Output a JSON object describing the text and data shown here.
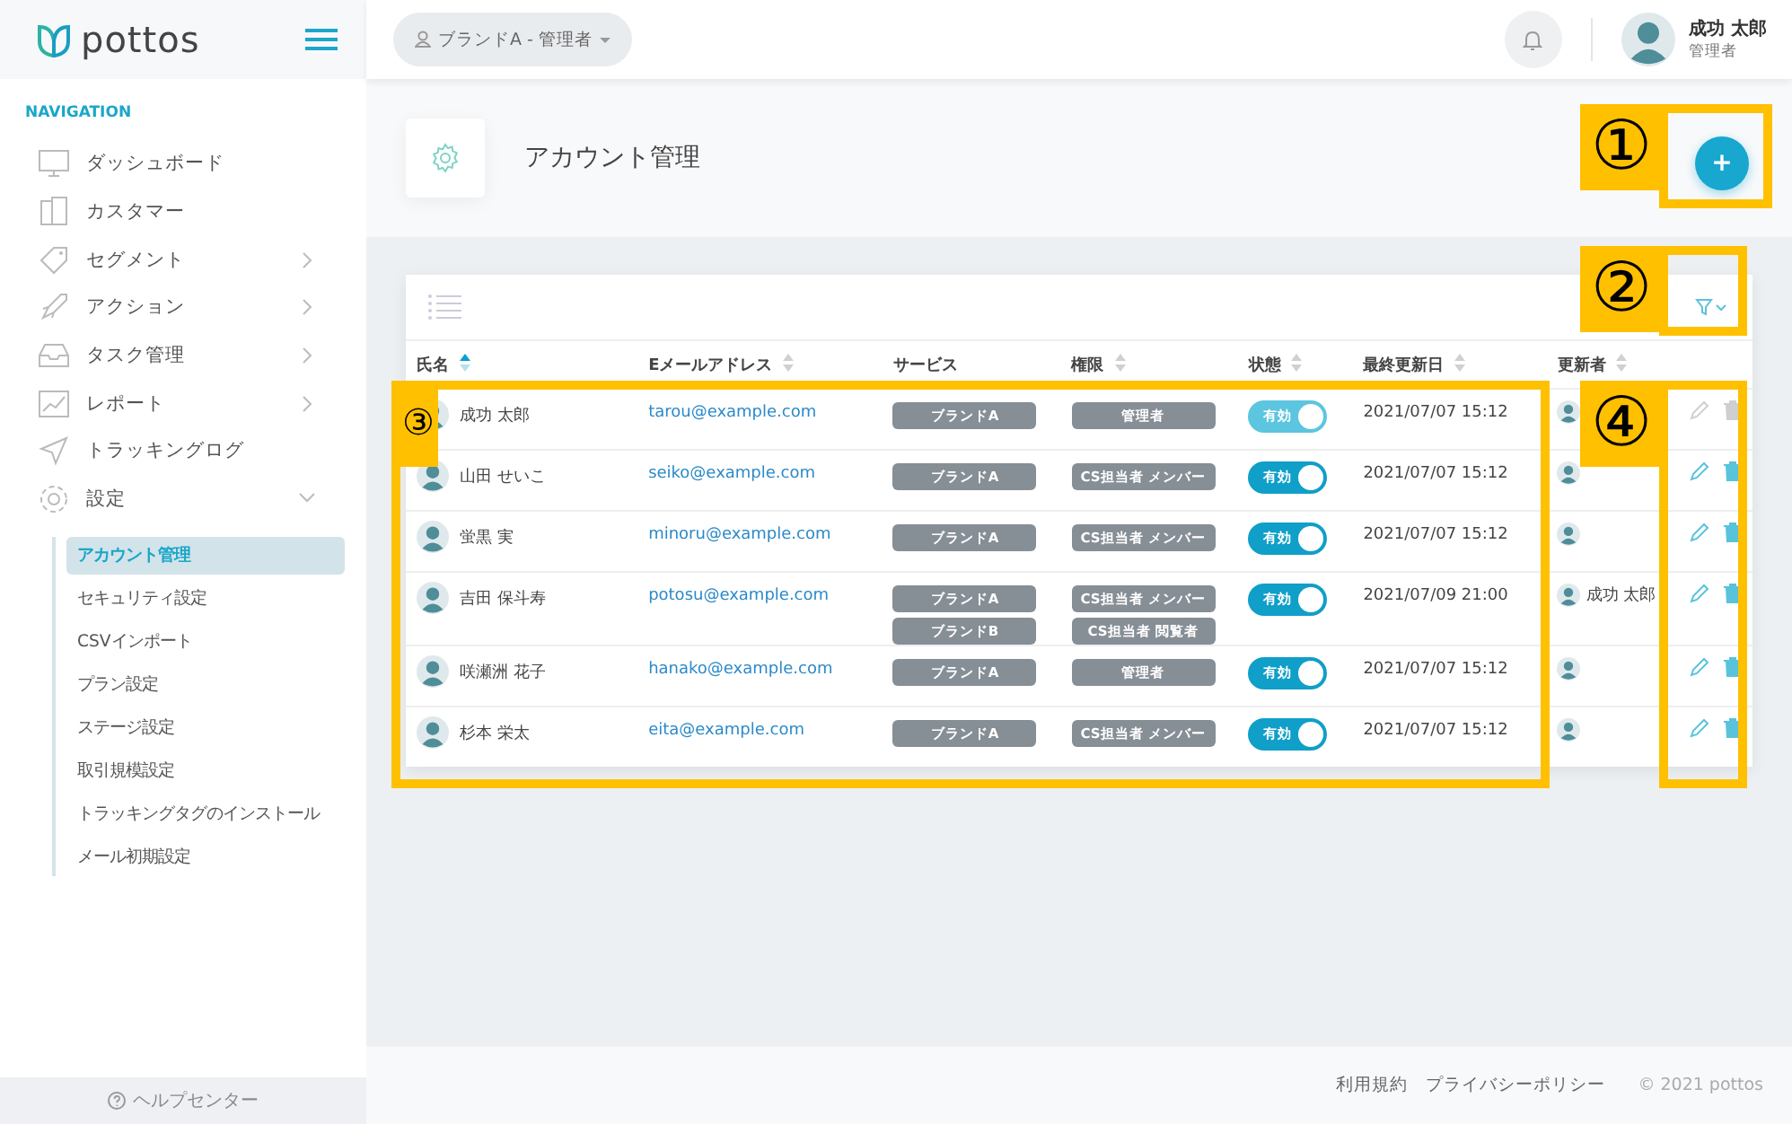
{
  "logo": {
    "text": "pottos"
  },
  "sidebar": {
    "section": "NAVIGATION",
    "items": [
      {
        "label": "ダッシュボード",
        "kind": "link"
      },
      {
        "label": "カスタマー",
        "kind": "link"
      },
      {
        "label": "セグメント",
        "kind": "group",
        "expanded": false
      },
      {
        "label": "アクション",
        "kind": "group",
        "expanded": false
      },
      {
        "label": "タスク管理",
        "kind": "group",
        "expanded": false
      },
      {
        "label": "レポート",
        "kind": "group",
        "expanded": false
      },
      {
        "label": "トラッキングログ",
        "kind": "link"
      },
      {
        "label": "設定",
        "kind": "group",
        "expanded": true
      }
    ],
    "sub_items": [
      {
        "label": "アカウント管理",
        "selected": true
      },
      {
        "label": "セキュリティ設定",
        "selected": false
      },
      {
        "label": "CSVインポート",
        "selected": false
      },
      {
        "label": "プラン設定",
        "selected": false
      },
      {
        "label": "ステージ設定",
        "selected": false
      },
      {
        "label": "取引規模設定",
        "selected": false
      },
      {
        "label": "トラッキングタグのインストール",
        "selected": false
      },
      {
        "label": "メール初期設定",
        "selected": false
      }
    ],
    "help": "ヘルプセンター"
  },
  "topbar": {
    "account_switch": "ブランドA - 管理者",
    "user": {
      "name": "成功 太郎",
      "role": "管理者"
    }
  },
  "page": {
    "title": "アカウント管理",
    "add_button": "+"
  },
  "table": {
    "columns": [
      {
        "label": "氏名",
        "sorted": true
      },
      {
        "label": "Eメールアドレス",
        "sorted": false
      },
      {
        "label": "サービス"
      },
      {
        "label": "権限",
        "sorted": false
      },
      {
        "label": "状態",
        "sorted": false
      },
      {
        "label": "最終更新日",
        "sorted": false
      },
      {
        "label": "更新者",
        "sorted": false
      }
    ],
    "rows": [
      {
        "name": "成功 太郎",
        "email": "tarou@example.com",
        "services": [
          "ブランドA"
        ],
        "roles": [
          "管理者"
        ],
        "status": "有効",
        "on": true,
        "updated": "2021/07/07 15:12",
        "disabled": true
      },
      {
        "name": "山田 せいこ",
        "email": "seiko@example.com",
        "services": [
          "ブランドA"
        ],
        "roles": [
          "CS担当者 メンバー"
        ],
        "status": "有効",
        "on": true,
        "updated": "2021/07/07 15:12",
        "disabled": false
      },
      {
        "name": "蛍黒 実",
        "email": "minoru@example.com",
        "services": [
          "ブランドA"
        ],
        "roles": [
          "CS担当者 メンバー"
        ],
        "status": "有効",
        "on": true,
        "updated": "2021/07/07 15:12",
        "disabled": false
      },
      {
        "name": "吉田 保斗寿",
        "email": "potosu@example.com",
        "services": [
          "ブランドA",
          "ブランドB"
        ],
        "roles": [
          "CS担当者 メンバー",
          "CS担当者 閲覧者"
        ],
        "status": "有効",
        "on": true,
        "updated": "2021/07/09 21:00",
        "updater": "成功 太郎",
        "disabled": false
      },
      {
        "name": "咲瀬洲 花子",
        "email": "hanako@example.com",
        "services": [
          "ブランドA"
        ],
        "roles": [
          "管理者"
        ],
        "status": "有効",
        "on": true,
        "updated": "2021/07/07 15:12",
        "disabled": false
      },
      {
        "name": "杉本 栄太",
        "email": "eita@example.com",
        "services": [
          "ブランドA"
        ],
        "roles": [
          "CS担当者 メンバー"
        ],
        "status": "有効",
        "on": true,
        "updated": "2021/07/07 15:12",
        "disabled": false
      }
    ]
  },
  "footer": {
    "links": [
      "利用規約",
      "プライバシーポリシー"
    ],
    "copyright": "© 2021 pottos"
  },
  "callouts": [
    {
      "label": "①"
    },
    {
      "label": "②"
    },
    {
      "label": "③"
    },
    {
      "label": "④"
    }
  ]
}
